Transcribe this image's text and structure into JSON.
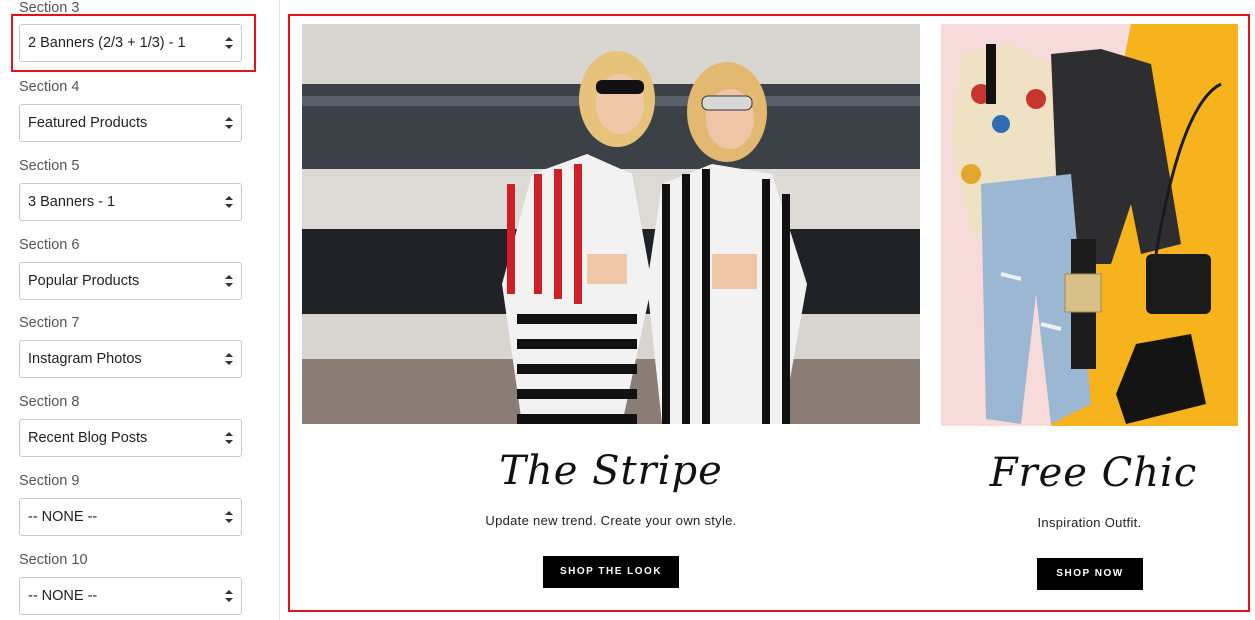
{
  "sidebar": {
    "sections": [
      {
        "label": "Section 3",
        "value": "2 Banners (2/3 + 1/3) - 1"
      },
      {
        "label": "Section 4",
        "value": "Featured Products"
      },
      {
        "label": "Section 5",
        "value": "3 Banners - 1"
      },
      {
        "label": "Section 6",
        "value": "Popular Products"
      },
      {
        "label": "Section 7",
        "value": "Instagram Photos"
      },
      {
        "label": "Section 8",
        "value": "Recent Blog Posts"
      },
      {
        "label": "Section 9",
        "value": "-- NONE --"
      },
      {
        "label": "Section 10",
        "value": "-- NONE --"
      }
    ]
  },
  "preview": {
    "banners": [
      {
        "title": "The Stripe",
        "subtitle": "Update new trend. Create your own style.",
        "button": "SHOP THE LOOK"
      },
      {
        "title": "Free Chic",
        "subtitle": "Inspiration Outfit.",
        "button": "SHOP NOW"
      }
    ]
  },
  "colors": {
    "highlight": "#e0141b",
    "button_bg": "#000000",
    "accent_yellow": "#f6b31b",
    "accent_pink": "#f7dada"
  }
}
